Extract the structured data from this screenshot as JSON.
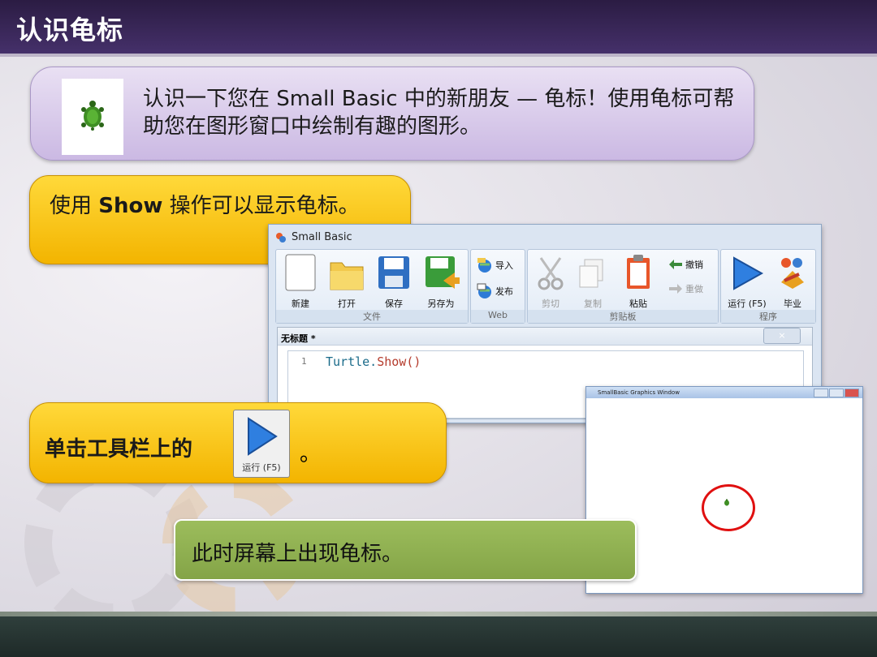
{
  "page": {
    "title": "认识龟标"
  },
  "intro": {
    "text": "认识一下您在 Small Basic 中的新朋友 — 龟标！使用龟标可帮助您在图形窗口中绘制有趣的图形。"
  },
  "callout_show": {
    "prefix": "使用 ",
    "bold": "Show",
    "suffix": " 操作可以显示龟标。"
  },
  "callout_run": {
    "text": "单击工具栏上的",
    "button_label": "运行 (F5)",
    "period": "。"
  },
  "callout_result": {
    "text": "此时屏幕上出现龟标。"
  },
  "smallbasic": {
    "window_title": "Small Basic",
    "groups": {
      "file": {
        "name": "文件",
        "new": "新建",
        "open": "打开",
        "save": "保存",
        "save_as": "另存为"
      },
      "web": {
        "name": "Web",
        "import": "导入",
        "publish": "发布"
      },
      "clipboard": {
        "name": "剪贴板",
        "cut": "剪切",
        "copy": "复制",
        "paste": "粘贴",
        "undo": "撤销",
        "redo": "重做"
      },
      "program": {
        "name": "程序",
        "run": "运行 (F5)",
        "graduate": "毕业"
      }
    },
    "editor": {
      "tab_title": "无标题 *",
      "close_label": "×",
      "line_number": "1",
      "code_obj": "Turtle.",
      "code_method": "Show()"
    }
  },
  "graphics_window": {
    "title": "SmallBasic Graphics Window"
  },
  "colors": {
    "accent_purple": "#45306a",
    "callout_yellow": "#f3b400",
    "callout_green": "#84a447",
    "ring_red": "#e01010"
  }
}
